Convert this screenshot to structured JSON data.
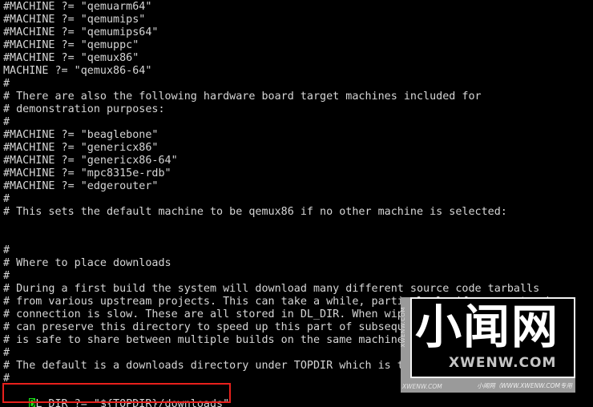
{
  "terminal": {
    "background_color": "#000000",
    "text_color": "#d6d6d6",
    "cursor_color": "#19e619",
    "lines": [
      "#MACHINE ?= \"qemuarm64\"",
      "#MACHINE ?= \"qemumips\"",
      "#MACHINE ?= \"qemumips64\"",
      "#MACHINE ?= \"qemuppc\"",
      "#MACHINE ?= \"qemux86\"",
      "MACHINE ?= \"qemux86-64\"",
      "#",
      "# There are also the following hardware board target machines included for",
      "# demonstration purposes:",
      "#",
      "#MACHINE ?= \"beaglebone\"",
      "#MACHINE ?= \"genericx86\"",
      "#MACHINE ?= \"genericx86-64\"",
      "#MACHINE ?= \"mpc8315e-rdb\"",
      "#MACHINE ?= \"edgerouter\"",
      "#",
      "# This sets the default machine to be qemux86 if no other machine is selected:",
      "",
      "",
      "#",
      "# Where to place downloads",
      "#",
      "# During a first build the system will download many different source code tarballs",
      "# from various upstream projects. This can take a while, particularly if your network",
      "# connection is slow. These are all stored in DL_DIR. When wiping and rebuilding you",
      "# can preserve this directory to speed up this part of subsequent builds. This directory",
      "# is safe to share between multiple builds on the same machine too.",
      "#",
      "# The default is a downloads directory under TOPDIR which is the build directory.",
      "#"
    ],
    "final_line": {
      "cursor_char": "D",
      "rest": "L_DIR ?= \"${TOPDIR}/downloads\""
    }
  },
  "annotation": {
    "highlight_color": "#e8201c"
  },
  "watermark": {
    "chinese_title": "小闻网",
    "domain": "XWENW.COM",
    "side_text": "XWENW.COM",
    "footer_left": "XWENW.COM",
    "footer_right": "小闻网（WWW.XWENW.COM专用"
  }
}
